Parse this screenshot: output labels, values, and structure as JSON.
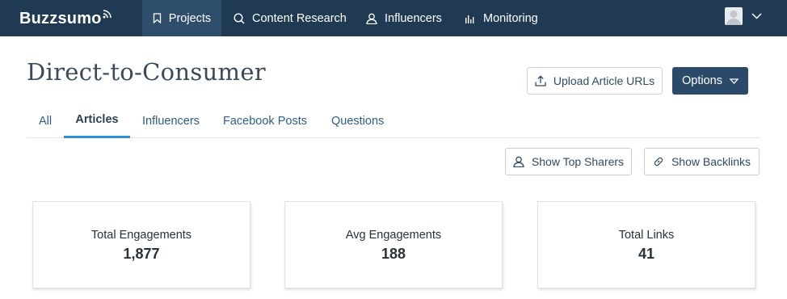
{
  "nav": {
    "logo": "Buzzsumo",
    "items": [
      {
        "label": "Projects",
        "icon": "bookmark-icon",
        "active": true
      },
      {
        "label": "Content Research",
        "icon": "search-icon"
      },
      {
        "label": "Influencers",
        "icon": "user-icon"
      },
      {
        "label": "Monitoring",
        "icon": "bar-chart-icon"
      }
    ],
    "user_icon": "user-avatar",
    "menu_icon": "chevron-down-icon"
  },
  "header": {
    "title": "Direct-to-Consumer",
    "upload_label": "Upload Article URLs",
    "options_label": "Options"
  },
  "tabs": [
    {
      "label": "All"
    },
    {
      "label": "Articles",
      "active": true
    },
    {
      "label": "Influencers"
    },
    {
      "label": "Facebook Posts"
    },
    {
      "label": "Questions"
    }
  ],
  "actions": {
    "top_sharers_label": "Show Top Sharers",
    "backlinks_label": "Show Backlinks"
  },
  "stats": [
    {
      "label": "Total Engagements",
      "value": "1,877"
    },
    {
      "label": "Avg Engagements",
      "value": "188"
    },
    {
      "label": "Total Links",
      "value": "41"
    }
  ],
  "colors": {
    "nav_bg": "#1f3a52",
    "nav_active": "#2e4e6c",
    "primary_button": "#2b4a69",
    "tab_active_underline": "#2f8fd6",
    "link": "#2c5d88"
  }
}
